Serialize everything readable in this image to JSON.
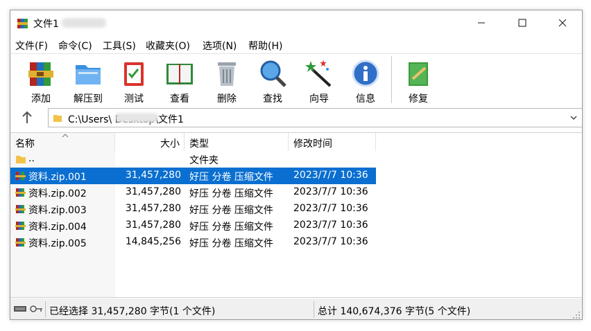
{
  "window": {
    "title": "文件1"
  },
  "menu": [
    "文件(F)",
    "命令(C)",
    "工具(S)",
    "收藏夹(O)",
    "选项(N)",
    "帮助(H)"
  ],
  "toolbar": [
    "添加",
    "解压到",
    "测试",
    "查看",
    "删除",
    "查找",
    "向导",
    "信息",
    "修复"
  ],
  "address": {
    "path": "C:\\Users\\        Desktop\\文件1"
  },
  "columns": {
    "name": "名称",
    "size": "大小",
    "type": "类型",
    "modified": "修改时间"
  },
  "rows": [
    {
      "name": "..",
      "size": "",
      "type": "文件夹",
      "modified": ""
    },
    {
      "name": "资料.zip.001",
      "size": "31,457,280",
      "type": "好压 分卷 压缩文件",
      "modified": "2023/7/7 10:36"
    },
    {
      "name": "资料.zip.002",
      "size": "31,457,280",
      "type": "好压 分卷 压缩文件",
      "modified": "2023/7/7 10:36"
    },
    {
      "name": "资料.zip.003",
      "size": "31,457,280",
      "type": "好压 分卷 压缩文件",
      "modified": "2023/7/7 10:36"
    },
    {
      "name": "资料.zip.004",
      "size": "31,457,280",
      "type": "好压 分卷 压缩文件",
      "modified": "2023/7/7 10:36"
    },
    {
      "name": "资料.zip.005",
      "size": "14,845,256",
      "type": "好压 分卷 压缩文件",
      "modified": "2023/7/7 10:36"
    }
  ],
  "status": {
    "selected": "已经选择 31,457,280 字节(1 个文件)",
    "total": "总计 140,674,376 字节(5 个文件)"
  },
  "icons": {
    "app": "winrar-books-icon",
    "folder": "folder-icon",
    "archive": "rar-archive-icon"
  },
  "colors": {
    "selection": "#0a6fd0",
    "folder": "#f2c24a"
  }
}
